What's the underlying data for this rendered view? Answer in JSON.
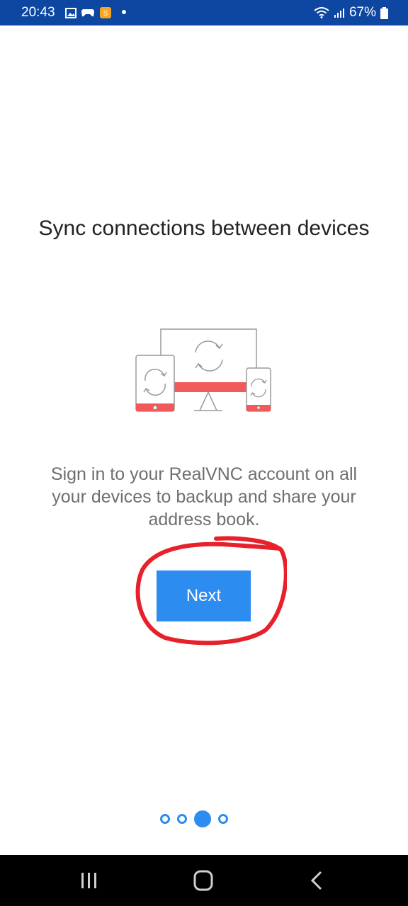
{
  "status_bar": {
    "time": "20:43",
    "battery": "67%",
    "icons": [
      "gallery-icon",
      "gamepad-icon",
      "app-notification-icon",
      "notification-dot",
      "wifi-icon",
      "signal-icon",
      "battery-icon"
    ]
  },
  "onboarding": {
    "title": "Sync connections between devices",
    "description": "Sign in to your RealVNC account on all your devices to backup and share your address book.",
    "next_label": "Next",
    "page_count": 4,
    "current_page": 3
  },
  "colors": {
    "status_bar": "#0d47a1",
    "accent": "#2d8cf0",
    "illustration_red": "#f25a5a",
    "annotation_red": "#e8202a",
    "nav_bar": "#000000"
  },
  "nav_bar": {
    "buttons": [
      "recent-apps-icon",
      "home-icon",
      "back-icon"
    ]
  }
}
